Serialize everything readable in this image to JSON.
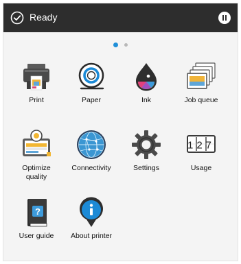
{
  "status_bar": {
    "status_text": "Ready",
    "status_icon": "check-circle-icon",
    "pause_icon": "pause-icon",
    "background": "#2d2d2d"
  },
  "pager": {
    "pages": 2,
    "current": 1,
    "active_color": "#1f8fd8"
  },
  "tiles": [
    {
      "label": "Print",
      "icon": "printer-icon"
    },
    {
      "label": "Paper",
      "icon": "paper-roll-icon"
    },
    {
      "label": "Ink",
      "icon": "ink-drop-icon"
    },
    {
      "label": "Job queue",
      "icon": "job-queue-icon"
    },
    {
      "label": "Optimize quality",
      "label_line1": "Optimize",
      "label_line2": "quality",
      "icon": "optimize-quality-icon"
    },
    {
      "label": "Connectivity",
      "icon": "globe-icon"
    },
    {
      "label": "Settings",
      "icon": "gear-icon"
    },
    {
      "label": "Usage",
      "icon": "counter-icon",
      "counter_value": "127"
    },
    {
      "label": "User guide",
      "icon": "user-guide-icon"
    },
    {
      "label": "About printer",
      "icon": "info-pin-icon"
    }
  ]
}
